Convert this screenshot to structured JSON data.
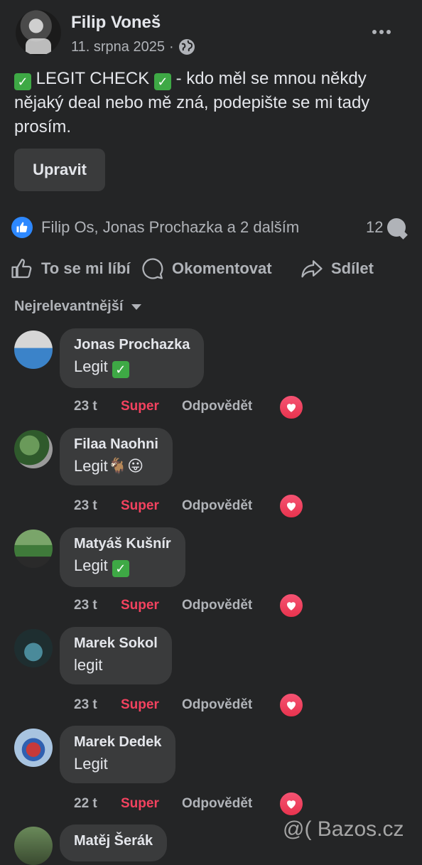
{
  "post": {
    "author": "Filip Voneš",
    "date": "11. srpna 2025",
    "separator": "·",
    "audience_icon": "globe-icon",
    "text_part1": "LEGIT CHECK",
    "text_part2": "- kdo měl se mnou někdy nějaký deal nebo mě zná, podepište se mi tady prosím.",
    "edit_label": "Upravit"
  },
  "reactions": {
    "summary": "Filip Os, Jonas Prochazka a 2 dalším",
    "comment_count": "12"
  },
  "actions": {
    "like": "To se mi líbí",
    "comment": "Okomentovat",
    "share": "Sdílet"
  },
  "sort_label": "Nejrelevantnější",
  "comments": [
    {
      "name": "Jonas Prochazka",
      "text": "Legit",
      "emoji": "check",
      "time": "23 t",
      "super": "Super",
      "reply": "Odpovědět"
    },
    {
      "name": "Filaa Naohni",
      "text": "Legit",
      "emoji": "goat-tongue",
      "time": "23 t",
      "super": "Super",
      "reply": "Odpovědět"
    },
    {
      "name": "Matyáš Kušnír",
      "text": "Legit",
      "emoji": "check",
      "time": "23 t",
      "super": "Super",
      "reply": "Odpovědět"
    },
    {
      "name": "Marek Sokol",
      "text": "legit",
      "emoji": "",
      "time": "23 t",
      "super": "Super",
      "reply": "Odpovědět"
    },
    {
      "name": "Marek Dedek",
      "text": "Legit",
      "emoji": "",
      "time": "22 t",
      "super": "Super",
      "reply": "Odpovědět"
    },
    {
      "name": "Matěj Šerák",
      "text": "",
      "emoji": "",
      "time": "",
      "super": "",
      "reply": ""
    }
  ],
  "watermark": "@( Bazos.cz",
  "colors": {
    "background": "#242526",
    "bubble": "#3a3b3c",
    "text": "#e4e6eb",
    "secondary": "#b0b3b8",
    "super": "#f3425f",
    "like_blue": "#2d88ff",
    "check_green": "#3ea945"
  }
}
